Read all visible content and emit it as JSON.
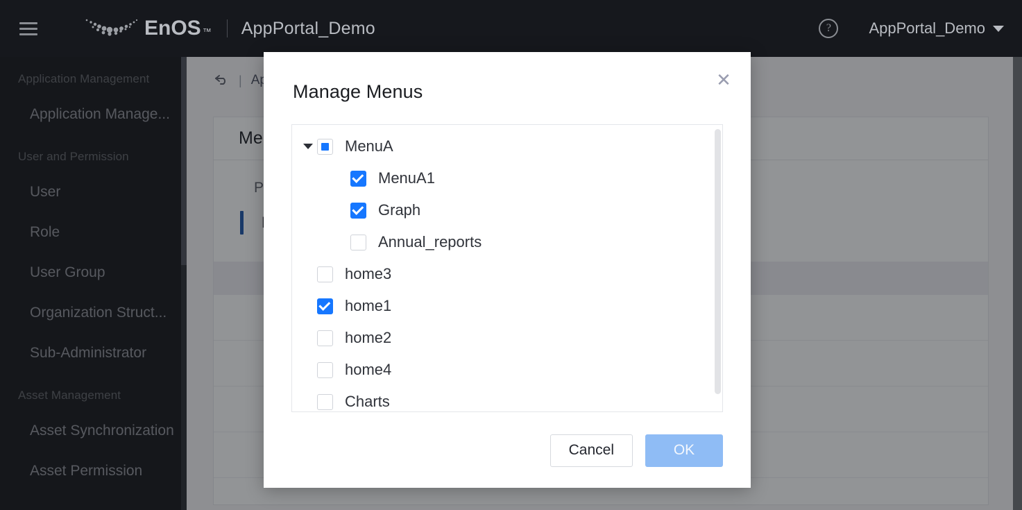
{
  "header": {
    "menu_icon": "hamburger-icon",
    "logo_text": "EnOS",
    "logo_tm": "™",
    "app_title": "AppPortal_Demo",
    "help_icon": "?",
    "user_name": "AppPortal_Demo",
    "caret_icon": "chevron-down-icon"
  },
  "sidebar": {
    "groups": [
      {
        "label": "Application Management",
        "items": [
          "Application Manage..."
        ]
      },
      {
        "label": "User and Permission",
        "items": [
          "User",
          "Role",
          "User Group",
          "Organization Struct...",
          "Sub-Administrator"
        ]
      },
      {
        "label": "Asset Management",
        "items": [
          "Asset Synchronization",
          "Asset Permission"
        ]
      }
    ]
  },
  "content": {
    "back_icon": "↰",
    "breadcrumb_sep": "|",
    "breadcrumb": "Ap",
    "card_title": "Men",
    "card_sub": "Po",
    "menu_row_label": "Me"
  },
  "modal": {
    "title": "Manage Menus",
    "close_icon": "✕",
    "tree": [
      {
        "label": "MenuA",
        "level": 0,
        "state": "indeterminate",
        "expandable": true
      },
      {
        "label": "MenuA1",
        "level": 1,
        "state": "checked",
        "expandable": false
      },
      {
        "label": "Graph",
        "level": 1,
        "state": "checked",
        "expandable": false
      },
      {
        "label": "Annual_reports",
        "level": 1,
        "state": "unchecked",
        "expandable": false
      },
      {
        "label": "home3",
        "level": 0,
        "state": "unchecked",
        "expandable": false
      },
      {
        "label": "home1",
        "level": 0,
        "state": "checked",
        "expandable": false
      },
      {
        "label": "home2",
        "level": 0,
        "state": "unchecked",
        "expandable": false
      },
      {
        "label": "home4",
        "level": 0,
        "state": "unchecked",
        "expandable": false
      },
      {
        "label": "Charts",
        "level": 0,
        "state": "unchecked",
        "expandable": false
      }
    ],
    "cancel_label": "Cancel",
    "ok_label": "OK"
  },
  "colors": {
    "accent_blue": "#1677ff",
    "ok_button": "#8fbcf5",
    "topbar_bg": "#16181d",
    "overlay": "rgba(20,22,26,0.45)"
  }
}
